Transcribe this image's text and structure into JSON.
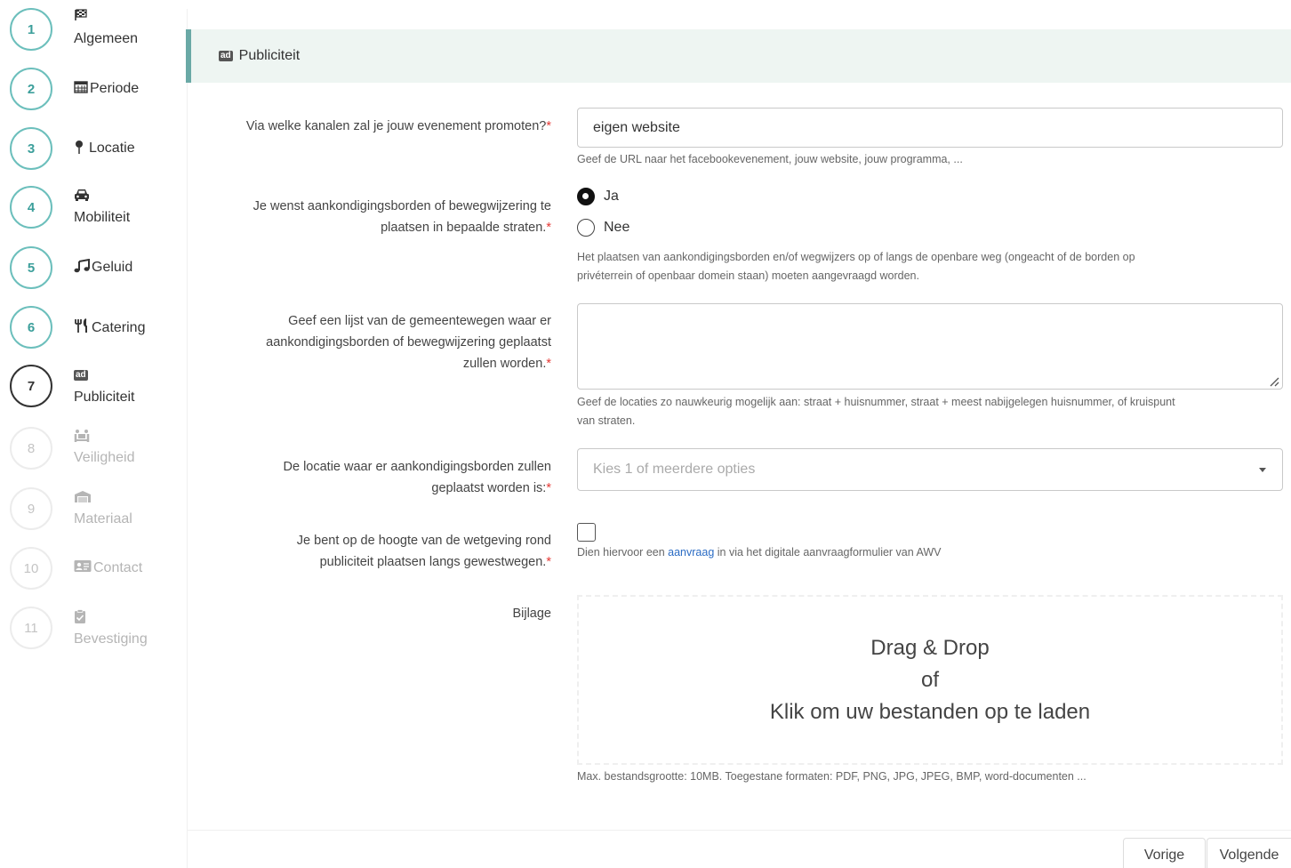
{
  "steps": [
    {
      "number": "1",
      "label": "Algemeen",
      "icon": "flag-checkered-icon"
    },
    {
      "number": "2",
      "label": "Periode",
      "icon": "calendar-icon"
    },
    {
      "number": "3",
      "label": "Locatie",
      "icon": "map-pin-icon"
    },
    {
      "number": "4",
      "label": "Mobiliteit",
      "icon": "car-icon"
    },
    {
      "number": "5",
      "label": "Geluid",
      "icon": "music-icon"
    },
    {
      "number": "6",
      "label": "Catering",
      "icon": "utensils-icon"
    },
    {
      "number": "7",
      "label": "Publiciteit",
      "icon": "ad-icon",
      "badge": "ad"
    },
    {
      "number": "8",
      "label": "Veiligheid",
      "icon": "people-carry-icon"
    },
    {
      "number": "9",
      "label": "Materiaal",
      "icon": "warehouse-icon"
    },
    {
      "number": "10",
      "label": "Contact",
      "icon": "address-card-icon"
    },
    {
      "number": "11",
      "label": "Bevestiging",
      "icon": "clipboard-check-icon"
    }
  ],
  "section": {
    "badge": "ad",
    "title": "Publiciteit"
  },
  "form": {
    "channels": {
      "label": "Via welke kanalen zal je jouw evenement promoten?",
      "required": "*",
      "value": "eigen website",
      "help": "Geef de URL naar het facebookevenement, jouw website, jouw programma, ..."
    },
    "signs": {
      "label_line1": "Je wenst aankondigingsborden of bewegwijzering te",
      "label_line2": "plaatsen in bepaalde straten.",
      "required": "*",
      "options": [
        "Ja",
        "Nee"
      ],
      "selected": "Ja",
      "help_line1": "Het plaatsen van aankondigingsborden en/of wegwijzers op of langs de openbare weg (ongeacht of de borden op",
      "help_line2": "privéterrein of openbaar domein staan) moeten aangevraagd worden."
    },
    "roads": {
      "label_line1": "Geef een lijst van de gemeentewegen waar er",
      "label_line2": "aankondigingsborden of bewegwijzering geplaatst",
      "label_line3": "zullen worden.",
      "required": "*",
      "value": "",
      "help_line1": "Geef de locaties zo nauwkeurig mogelijk aan: straat + huisnummer, straat + meest nabijgelegen huisnummer, of kruispunt",
      "help_line2": "van straten."
    },
    "location": {
      "label_line1": "De locatie waar er aankondigingsborden zullen",
      "label_line2": "geplaatst worden is:",
      "required": "*",
      "placeholder": "Kies 1 of meerdere opties"
    },
    "legislation": {
      "label_line1": "Je bent op de hoogte van de wetgeving rond",
      "label_line2": "publiciteit plaatsen langs gewestwegen.",
      "required": "*",
      "checked": false,
      "help_before": "Dien hiervoor een ",
      "help_link": "aanvraag",
      "help_after": " in via het digitale aanvraagformulier van AWV"
    },
    "attachment": {
      "label": "Bijlage",
      "drop_line1": "Drag & Drop",
      "drop_line2": "of",
      "drop_line3": "Klik om uw bestanden op te laden",
      "help": "Max. bestandsgrootte: 10MB. Toegestane formaten: PDF, PNG, JPG, JPEG, BMP, word-documenten ..."
    }
  },
  "buttons": {
    "previous": "Vorige",
    "next": "Volgende"
  },
  "colors": {
    "accent": "#6aa9a6",
    "step_ring": "#6cbfbc",
    "required": "#e53935",
    "link": "#2b6cc4",
    "header_bg": "#eef5f2"
  }
}
